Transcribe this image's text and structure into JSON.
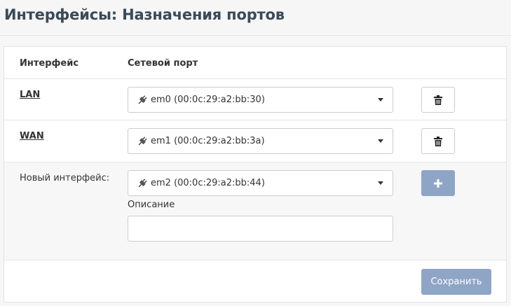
{
  "page": {
    "title": "Интерфейсы: Назначения портов"
  },
  "table": {
    "headers": {
      "interface": "Интерфейс",
      "network_port": "Сетевой порт"
    },
    "rows": [
      {
        "interface": "LAN",
        "port": "em0 (00:0c:29:a2:bb:30)"
      },
      {
        "interface": "WAN",
        "port": "em1 (00:0c:29:a2:bb:3a)"
      }
    ],
    "new_interface": {
      "label": "Новый интерфейс:",
      "port": "em2 (00:0c:29:a2:bb:44)",
      "description_label": "Описание",
      "description_value": ""
    }
  },
  "buttons": {
    "save": "Сохранить"
  },
  "icons": {
    "port": "plug-icon",
    "delete": "trash-icon",
    "add": "plus-icon",
    "dropdown": "caret-down-icon"
  },
  "colors": {
    "title": "#3b4a58",
    "primary_button": "#8fa5c6"
  }
}
